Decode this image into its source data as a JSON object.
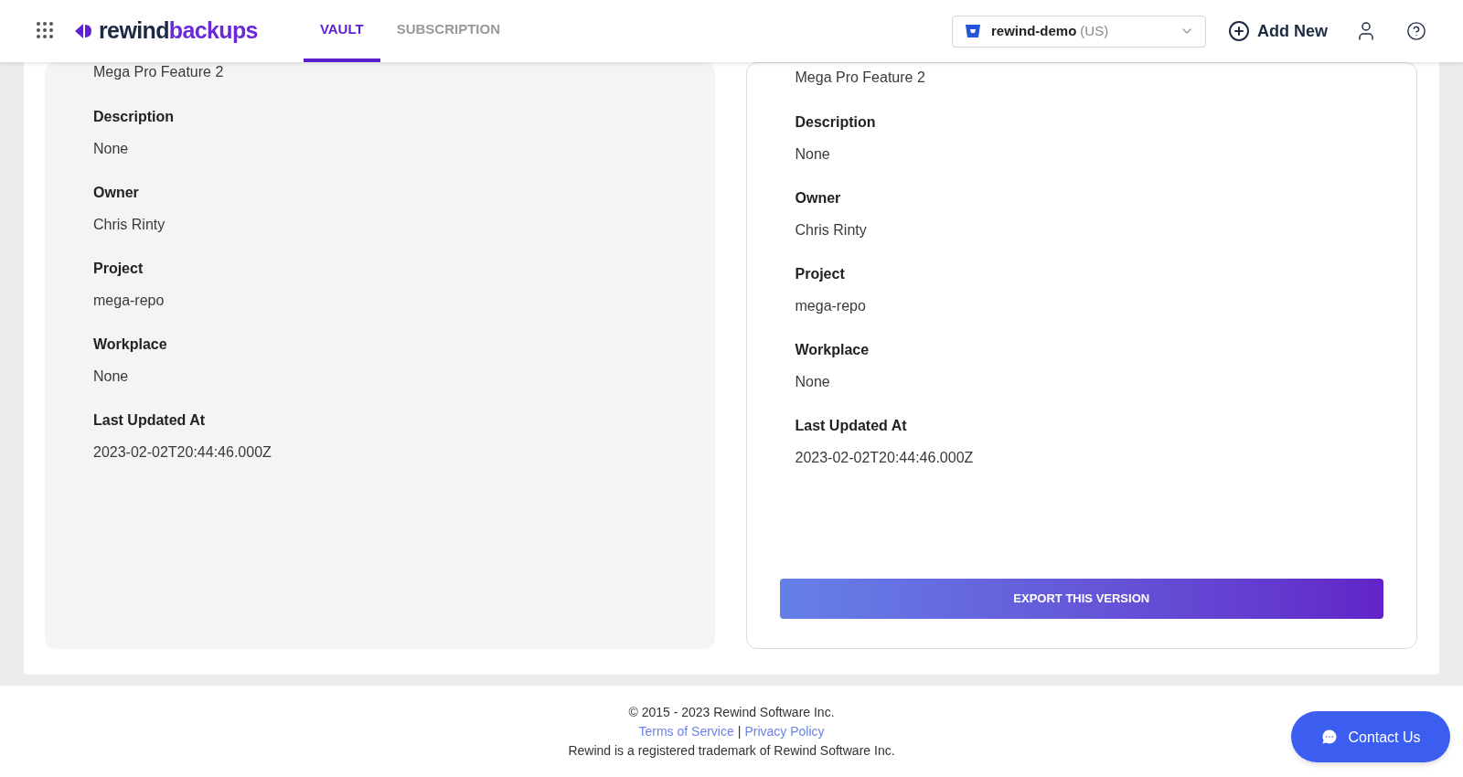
{
  "header": {
    "logo": {
      "part1": "rewind",
      "part2": "backups"
    },
    "tabs": [
      {
        "label": "VAULT",
        "selected": true
      },
      {
        "label": "SUBSCRIPTION",
        "selected": false
      }
    ],
    "account": {
      "name": "rewind-demo",
      "region": "(US)"
    },
    "add_button": "Add New"
  },
  "panels": [
    {
      "kind": "current",
      "top_value": "Mega Pro Feature 2",
      "fields": [
        {
          "label": "Description",
          "value": "None"
        },
        {
          "label": "Owner",
          "value": "Chris Rinty"
        },
        {
          "label": "Project",
          "value": "mega-repo"
        },
        {
          "label": "Workplace",
          "value": "None"
        },
        {
          "label": "Last Updated At",
          "value": "2023-02-02T20:44:46.000Z"
        }
      ]
    },
    {
      "kind": "version",
      "top_value": "Mega Pro Feature 2",
      "fields": [
        {
          "label": "Description",
          "value": "None"
        },
        {
          "label": "Owner",
          "value": "Chris Rinty"
        },
        {
          "label": "Project",
          "value": "mega-repo"
        },
        {
          "label": "Workplace",
          "value": "None"
        },
        {
          "label": "Last Updated At",
          "value": "2023-02-02T20:44:46.000Z"
        }
      ],
      "button": "EXPORT THIS VERSION"
    }
  ],
  "footer": {
    "copyright": "© 2015 - 2023 Rewind Software Inc.",
    "links": [
      "Terms of Service",
      "Privacy Policy"
    ],
    "separator": "|",
    "trademark": "Rewind is a registered trademark of Rewind Software Inc."
  },
  "chat_button": "Contact Us"
}
